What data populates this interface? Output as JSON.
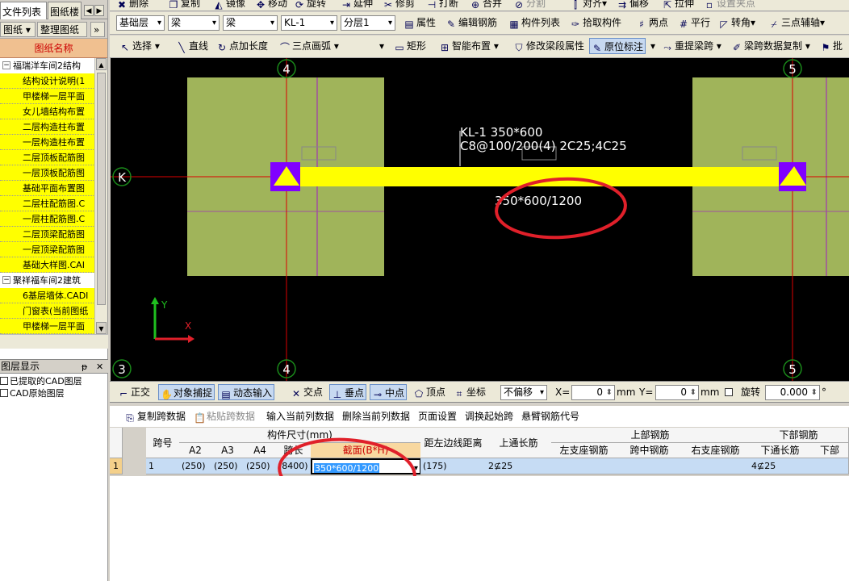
{
  "left_panel": {
    "tabs": [
      "文件列表",
      "图纸楼"
    ],
    "toolbar": {
      "btn1": "图纸",
      "btn2": "整理图纸",
      "more": "»"
    },
    "list_header": "图纸名称",
    "items": [
      {
        "type": "group",
        "label": "福瑞洋车间2结构"
      },
      {
        "type": "leaf",
        "label": "结构设计说明(1"
      },
      {
        "type": "leaf",
        "label": "甲楼梯一层平面"
      },
      {
        "type": "leaf",
        "label": "女儿墙结构布置"
      },
      {
        "type": "leaf",
        "label": "二层构造柱布置"
      },
      {
        "type": "leaf",
        "label": "一层构造柱布置"
      },
      {
        "type": "leaf",
        "label": "二层顶板配筋图"
      },
      {
        "type": "leaf",
        "label": "一层顶板配筋图"
      },
      {
        "type": "leaf",
        "label": "基础平面布置图"
      },
      {
        "type": "leaf",
        "label": "二层柱配筋图.C"
      },
      {
        "type": "leaf",
        "label": "一层柱配筋图.C"
      },
      {
        "type": "leaf",
        "label": "二层顶梁配筋图"
      },
      {
        "type": "leaf",
        "label": "一层顶梁配筋图"
      },
      {
        "type": "leaf",
        "label": "基础大样图.CAI"
      },
      {
        "type": "group",
        "label": "聚祥福车间2建筑"
      },
      {
        "type": "leaf",
        "label": "6基层墙体.CADI"
      },
      {
        "type": "leaf",
        "label": "门窗表(当前图纸"
      },
      {
        "type": "leaf",
        "label": "甲楼梯一层平面"
      }
    ],
    "layer_header": "图层显示",
    "layers": [
      "已提取的CAD图层",
      "CAD原始图层"
    ]
  },
  "toolbar1": {
    "items": [
      "删除",
      "复制",
      "镜像",
      "移动",
      "旋转",
      "延伸",
      "修剪",
      "打断",
      "合并",
      "分割",
      "对齐",
      "偏移",
      "拉伸",
      "设置夹点"
    ]
  },
  "toolbar2": {
    "floor": "基础层",
    "type": "梁",
    "subtype": "梁",
    "member": "KL-1",
    "layer": "分层1",
    "properties": "属性",
    "edit_rebar": "编辑钢筋",
    "member_list": "构件列表",
    "pick": "拾取构件",
    "two_points": "两点",
    "parallel": "平行",
    "corner": "转角",
    "three_point_aux": "三点辅轴"
  },
  "toolbar3": {
    "select": "选择",
    "line": "直线",
    "point_len": "点加长度",
    "arc": "三点画弧",
    "rect": "矩形",
    "smart": "智能布置",
    "edit_span": "修改梁段属性",
    "inplace": "原位标注",
    "reextract": "重提梁跨",
    "copy_span": "梁跨数据复制",
    "batch": "批"
  },
  "canvas": {
    "axis_labels": {
      "k": "K",
      "n4_top": "4",
      "n5_top": "5",
      "n4_bottom": "4",
      "n5_bottom": "5",
      "n3": "3"
    },
    "beam_label_1": "KL-1 350*600",
    "beam_label_2": "C8@100/200(4) 2C25;4C25",
    "beam_section": "350*600/1200",
    "axis_y": "Y",
    "axis_x": "X"
  },
  "snapbar": {
    "ortho": "正交",
    "snap": "对象捕捉",
    "dynamic": "动态输入",
    "intersect": "交点",
    "perp": "垂点",
    "mid": "中点",
    "vertex": "顶点",
    "coord": "坐标",
    "offset": "不偏移",
    "x_label": "X=",
    "x_val": "0",
    "mm1": "mm",
    "y_label": "Y=",
    "y_val": "0",
    "mm2": "mm",
    "rotate": "旋转",
    "rot_val": "0.000",
    "deg": "°"
  },
  "grid_toolbar": {
    "copy": "复制跨数据",
    "paste": "粘贴跨数据",
    "input_col": "输入当前列数据",
    "del_col": "删除当前列数据",
    "page": "页面设置",
    "swap": "调换起始跨",
    "cantilever": "悬臂钢筋代号"
  },
  "table": {
    "headers": {
      "span_no": "跨号",
      "dims": "构件尺寸(mm)",
      "a2": "A2",
      "a3": "A3",
      "a4": "A4",
      "span_len": "跨长",
      "section": "截面(B*H)",
      "dist": "距左边线距离",
      "top_long": "上通长筋",
      "top_rebar": "上部钢筋",
      "left_sup": "左支座钢筋",
      "mid_span": "跨中钢筋",
      "right_sup": "右支座钢筋",
      "bottom_rebar": "下部钢筋",
      "bot_long": "下通长筋",
      "bot_more": "下部"
    },
    "row": {
      "idx": "1",
      "span": "1",
      "a2": "(250)",
      "a3": "(250)",
      "a4": "(250)",
      "span_len": "(8400)",
      "section": "350*600/1200",
      "dist": "(175)",
      "top_long": "2⊈25",
      "left_sup": "",
      "mid_span": "",
      "right_sup": "",
      "bot_long": "4⊈25"
    }
  }
}
